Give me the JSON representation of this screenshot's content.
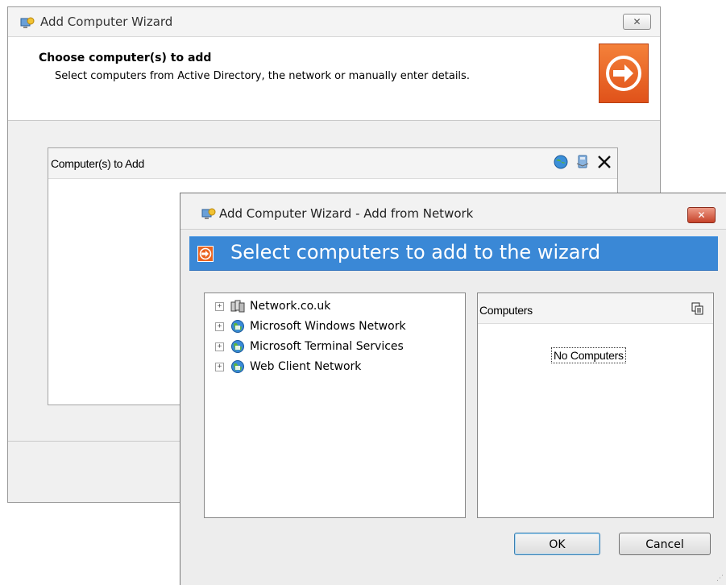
{
  "back_window": {
    "title": "Add Computer Wizard",
    "close_label": "✕",
    "header": {
      "title": "Choose computer(s) to add",
      "subtitle": "Select computers from Active Directory, the network or manually enter details."
    },
    "panel": {
      "title": "Computer(s) to Add",
      "toolbar_icons": [
        "globe-icon",
        "computer-icon",
        "close-icon"
      ]
    }
  },
  "front_dialog": {
    "title": "Add Computer Wizard - Add from Network",
    "close_label": "✕",
    "banner_title": "Select computers to add to the wizard",
    "tree": [
      {
        "label": "Network.co.uk",
        "icon": "domain-icon",
        "expander": "+"
      },
      {
        "label": "Microsoft Windows Network",
        "icon": "network-globe-icon",
        "expander": "+"
      },
      {
        "label": "Microsoft Terminal Services",
        "icon": "network-globe-icon",
        "expander": "+"
      },
      {
        "label": "Web Client Network",
        "icon": "network-globe-icon",
        "expander": "+"
      }
    ],
    "computers_panel": {
      "title": "Computers",
      "empty_text": "No Computers"
    },
    "buttons": {
      "ok": "OK",
      "cancel": "Cancel"
    }
  },
  "colors": {
    "banner_blue": "#3a88d6",
    "wizard_orange": "#e9631f",
    "close_red": "#c6432a"
  }
}
